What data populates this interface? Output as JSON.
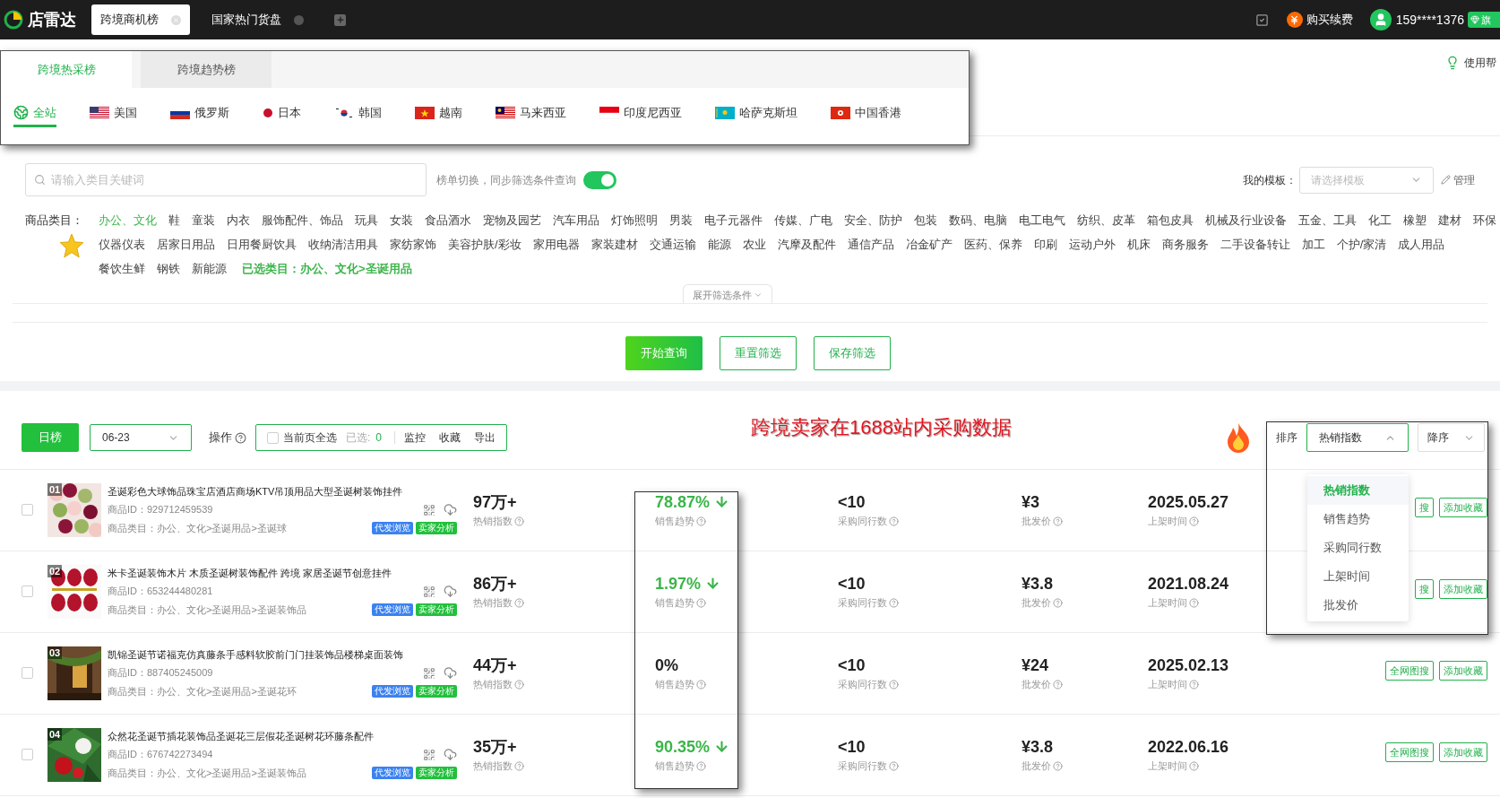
{
  "app": {
    "logo": "店雷达",
    "tabs": [
      {
        "label": "跨境商机榜",
        "selected": true
      },
      {
        "label": "国家热门货盘",
        "selected": false
      }
    ],
    "buy": "购买续费",
    "user": "159****1376",
    "badge": "旗"
  },
  "board_tabs": [
    {
      "label": "跨境热采榜",
      "selected": true
    },
    {
      "label": "跨境趋势榜",
      "selected": false
    }
  ],
  "countries": [
    {
      "label": "全站",
      "selected": true
    },
    {
      "label": "美国",
      "selected": false
    },
    {
      "label": "俄罗斯",
      "selected": false
    },
    {
      "label": "日本",
      "selected": false
    },
    {
      "label": "韩国",
      "selected": false
    },
    {
      "label": "越南",
      "selected": false
    },
    {
      "label": "马来西亚",
      "selected": false
    },
    {
      "label": "印度尼西亚",
      "selected": false
    },
    {
      "label": "哈萨克斯坦",
      "selected": false
    },
    {
      "label": "中国香港",
      "selected": false
    }
  ],
  "help": "使用帮",
  "search": {
    "placeholder": "请输入类目关键词"
  },
  "sync": {
    "label": "榜单切换，同步筛选条件查询",
    "on": true
  },
  "template": {
    "label": "我的模板：",
    "placeholder": "请选择模板",
    "manage": "管理"
  },
  "categories": {
    "label": "商品类目：",
    "items": [
      {
        "label": "办公、文化",
        "selected": true
      },
      {
        "label": "鞋",
        "selected": false
      },
      {
        "label": "童装",
        "selected": false
      },
      {
        "label": "内衣",
        "selected": false
      },
      {
        "label": "服饰配件、饰品",
        "selected": false
      },
      {
        "label": "玩具",
        "selected": false
      },
      {
        "label": "女装",
        "selected": false
      },
      {
        "label": "食品酒水",
        "selected": false
      },
      {
        "label": "宠物及园艺",
        "selected": false
      },
      {
        "label": "汽车用品",
        "selected": false
      },
      {
        "label": "灯饰照明",
        "selected": false
      },
      {
        "label": "男装",
        "selected": false
      },
      {
        "label": "电子元器件",
        "selected": false
      },
      {
        "label": "传媒、广电",
        "selected": false
      },
      {
        "label": "安全、防护",
        "selected": false
      },
      {
        "label": "包装",
        "selected": false
      },
      {
        "label": "数码、电脑",
        "selected": false
      },
      {
        "label": "电工电气",
        "selected": false
      },
      {
        "label": "纺织、皮革",
        "selected": false
      },
      {
        "label": "箱包皮具",
        "selected": false
      },
      {
        "label": "机械及行业设备",
        "selected": false
      },
      {
        "label": "五金、工具",
        "selected": false
      },
      {
        "label": "化工",
        "selected": false
      },
      {
        "label": "橡塑",
        "selected": false
      },
      {
        "label": "建材",
        "selected": false
      },
      {
        "label": "环保",
        "selected": false
      },
      {
        "label": "仪器仪表",
        "selected": false
      },
      {
        "label": "居家日用品",
        "selected": false
      },
      {
        "label": "日用餐厨饮具",
        "selected": false
      },
      {
        "label": "收纳清洁用具",
        "selected": false
      },
      {
        "label": "家纺家饰",
        "selected": false
      },
      {
        "label": "美容护肤/彩妆",
        "selected": false
      },
      {
        "label": "家用电器",
        "selected": false
      },
      {
        "label": "家装建材",
        "selected": false
      },
      {
        "label": "交通运输",
        "selected": false
      },
      {
        "label": "能源",
        "selected": false
      },
      {
        "label": "农业",
        "selected": false
      },
      {
        "label": "汽摩及配件",
        "selected": false
      },
      {
        "label": "通信产品",
        "selected": false
      },
      {
        "label": "冶金矿产",
        "selected": false
      },
      {
        "label": "医药、保养",
        "selected": false
      },
      {
        "label": "印刷",
        "selected": false
      },
      {
        "label": "运动户外",
        "selected": false
      },
      {
        "label": "机床",
        "selected": false
      },
      {
        "label": "商务服务",
        "selected": false
      },
      {
        "label": "二手设备转让",
        "selected": false
      },
      {
        "label": "加工",
        "selected": false
      },
      {
        "label": "个护/家清",
        "selected": false
      },
      {
        "label": "成人用品",
        "selected": false
      },
      {
        "label": "餐饮生鲜",
        "selected": false
      },
      {
        "label": "钢铁",
        "selected": false
      },
      {
        "label": "新能源",
        "selected": false
      }
    ],
    "chosen": "已选类目：办公、文化>圣诞用品"
  },
  "expand": "展开筛选条件",
  "actions": [
    "开始查询",
    "重置筛选",
    "保存筛选"
  ],
  "toolbar": {
    "period": "日榜",
    "date": "06-23",
    "ops": "操作",
    "select_all": {
      "label": "当前页全选",
      "checked": false
    },
    "selected_label": "已选:",
    "selected_count": "0",
    "links": [
      "监控",
      "收藏",
      "导出"
    ]
  },
  "annotation": "跨境卖家在1688站内采购数据",
  "sort": {
    "label": "排序",
    "field": "热销指数",
    "expanded": true,
    "order": "降序",
    "options": [
      {
        "label": "热销指数",
        "selected": true
      },
      {
        "label": "销售趋势",
        "selected": false
      },
      {
        "label": "采购同行数",
        "selected": false
      },
      {
        "label": "上架时间",
        "selected": false
      },
      {
        "label": "批发价",
        "selected": false
      }
    ]
  },
  "products": [
    {
      "no": "01",
      "title": "圣诞彩色大球饰品珠宝店酒店商场KTV吊顶用品大型圣诞树装饰挂件",
      "id": "商品ID：929712459539",
      "category": "商品类目：办公、文化>圣诞用品>圣诞球",
      "tags": [
        {
          "label": "代发浏览",
          "color": "#3b82f0"
        },
        {
          "label": "卖家分析",
          "color": "#22c03c"
        }
      ],
      "checked": false,
      "hot": "97万+",
      "hot_label": "热销指数",
      "trend": "78.87%",
      "falling": true,
      "trend_label": "销售趋势",
      "peers": "<10",
      "peers_label": "采购同行数",
      "price": "¥3",
      "price_label": "批发价",
      "date": "2025.05.27",
      "date_label": "上架时间",
      "buttons": [
        "搜",
        "添加收藏"
      ]
    },
    {
      "no": "02",
      "title": "米卡圣诞装饰木片 木质圣诞树装饰配件 跨境 家居圣诞节创意挂件",
      "id": "商品ID：653244480281",
      "category": "商品类目：办公、文化>圣诞用品>圣诞装饰品",
      "tags": [
        {
          "label": "代发浏览",
          "color": "#3b82f0"
        },
        {
          "label": "卖家分析",
          "color": "#22c03c"
        }
      ],
      "checked": false,
      "hot": "86万+",
      "hot_label": "热销指数",
      "trend": "1.97%",
      "falling": true,
      "trend_label": "销售趋势",
      "peers": "<10",
      "peers_label": "采购同行数",
      "price": "¥3.8",
      "price_label": "批发价",
      "date": "2021.08.24",
      "date_label": "上架时间",
      "buttons": [
        "搜",
        "添加收藏"
      ]
    },
    {
      "no": "03",
      "title": "凯锦圣诞节诺福克仿真藤条手感料软胶前门门挂装饰品楼梯桌面装饰",
      "id": "商品ID：887405245009",
      "category": "商品类目：办公、文化>圣诞用品>圣诞花环",
      "tags": [
        {
          "label": "代发浏览",
          "color": "#3b82f0"
        },
        {
          "label": "卖家分析",
          "color": "#22c03c"
        }
      ],
      "checked": false,
      "hot": "44万+",
      "hot_label": "热销指数",
      "trend": "0%",
      "falling": false,
      "trend_label": "销售趋势",
      "peers": "<10",
      "peers_label": "采购同行数",
      "price": "¥24",
      "price_label": "批发价",
      "date": "2025.02.13",
      "date_label": "上架时间",
      "buttons": [
        "全网图搜",
        "添加收藏"
      ]
    },
    {
      "no": "04",
      "title": "众然花圣诞节插花装饰品圣诞花三层假花圣诞树花环藤条配件",
      "id": "商品ID：676742273494",
      "category": "商品类目：办公、文化>圣诞用品>圣诞装饰品",
      "tags": [
        {
          "label": "代发浏览",
          "color": "#3b82f0"
        },
        {
          "label": "卖家分析",
          "color": "#22c03c"
        }
      ],
      "checked": false,
      "hot": "35万+",
      "hot_label": "热销指数",
      "trend": "90.35%",
      "falling": true,
      "trend_label": "销售趋势",
      "peers": "<10",
      "peers_label": "采购同行数",
      "price": "¥3.8",
      "price_label": "批发价",
      "date": "2022.06.16",
      "date_label": "上架时间",
      "buttons": [
        "全网图搜",
        "添加收藏"
      ]
    }
  ]
}
